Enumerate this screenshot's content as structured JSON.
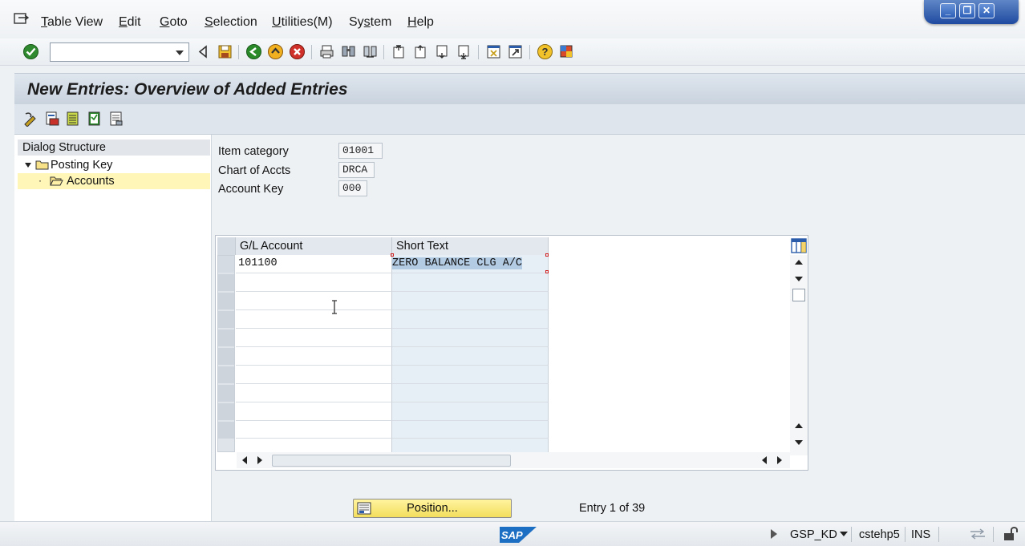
{
  "menu": {
    "items": [
      {
        "pre": "",
        "u": "T",
        "rest": "able View"
      },
      {
        "pre": "",
        "u": "E",
        "rest": "dit"
      },
      {
        "pre": "",
        "u": "G",
        "rest": "oto"
      },
      {
        "pre": "",
        "u": "S",
        "rest": "election"
      },
      {
        "pre": "",
        "u": "U",
        "rest": "tilities(M)"
      },
      {
        "pre": "Sy",
        "u": "s",
        "rest": "tem"
      },
      {
        "pre": "",
        "u": "H",
        "rest": "elp"
      }
    ]
  },
  "toolbar": {
    "command_value": ""
  },
  "title": "New Entries: Overview of Added Entries",
  "dialog_structure": {
    "header": "Dialog Structure",
    "items": [
      {
        "label": "Posting Key"
      },
      {
        "label": "Accounts"
      }
    ]
  },
  "fields": [
    {
      "label": "Item category",
      "value": "01001"
    },
    {
      "label": "Chart of Accts",
      "value": "DRCA"
    },
    {
      "label": "Account Key",
      "value": "000"
    }
  ],
  "table": {
    "columns": [
      "G/L Account",
      "Short Text"
    ],
    "rows": [
      {
        "gl": "101100",
        "short_text": "ZERO BALANCE CLG A/C"
      }
    ]
  },
  "position_button": "Position...",
  "entry_status": "Entry 1 of 39",
  "status_bar": {
    "system": "GSP_KD",
    "server": "cstehp5",
    "mode": "INS",
    "logo_text": "SAP"
  },
  "colors": {
    "title_bg": "#c9d3de",
    "selected_tree_bg": "#fff6b8",
    "position_button_bg": "#f3de5c",
    "window_controls": "#1f4aa0"
  }
}
